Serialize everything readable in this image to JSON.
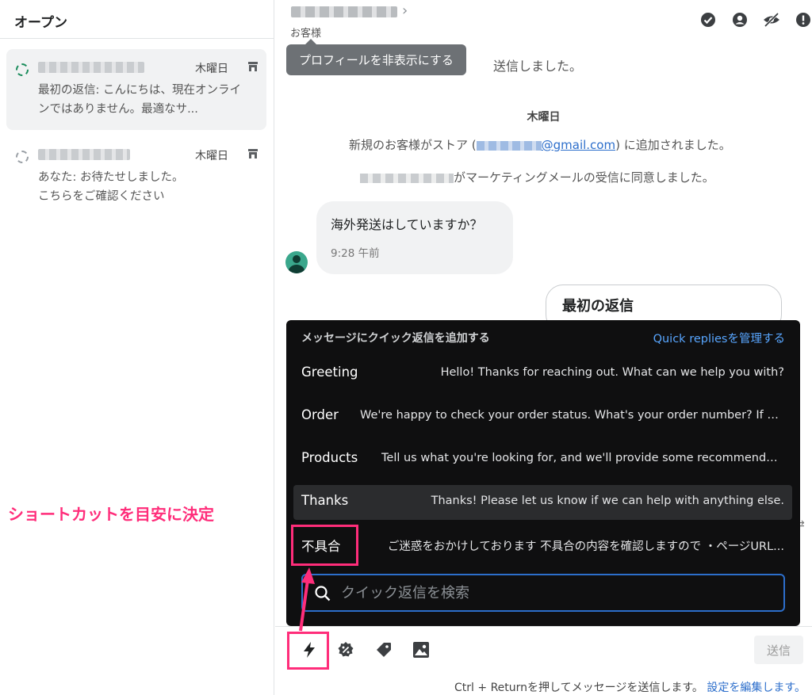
{
  "sidebar": {
    "title": "オープン",
    "conversations": [
      {
        "day": "木曜日",
        "preview": "最初の返信: こんにちは、現在オンラインではありません。最適なサ...",
        "selected": true
      },
      {
        "day": "木曜日",
        "preview_line1": "あなた: お待たせしました。",
        "preview_line2": "こちらをご確認ください",
        "selected": false
      }
    ]
  },
  "header": {
    "customer_label": "お客様",
    "icons": [
      "check-circle-icon",
      "profile-icon",
      "hide-icon",
      "alert-icon"
    ]
  },
  "tooltip": "プロフィールを非表示にする",
  "messages": {
    "partial_sent": "送信しました。",
    "day_label": "木曜日",
    "store_join_prefix": "新規のお客様がストア (",
    "email_suffix": "@gmail.com",
    "store_join_suffix": ") に追加されました。",
    "marketing": "がマーケティングメールの受信に同意しました。",
    "customer_message": "海外発送はしていますか？",
    "customer_time": "9:28 午前",
    "reply_card_title": "最初の返信"
  },
  "quick_replies": {
    "header": "メッセージにクイック返信を追加する",
    "manage_link": "Quick repliesを管理する",
    "items": [
      {
        "title": "Greeting",
        "text": "Hello! Thanks for reaching out. What can we help you with?"
      },
      {
        "title": "Order",
        "text": "We're happy to check your order status. What's your order number? If yo..."
      },
      {
        "title": "Products",
        "text": "Tell us what you're looking for, and we'll provide some recommendatio..."
      },
      {
        "title": "Thanks",
        "text": "Thanks! Please let us know if we can help with anything else."
      },
      {
        "title": "不具合",
        "text": "ご迷惑をおかけしております 不具合の内容を確認しますので ・ページURL..."
      }
    ],
    "search_placeholder": "クイック返信を検索"
  },
  "composer": {
    "tools": [
      "lightning-icon",
      "discount-icon",
      "tag-icon",
      "image-icon"
    ],
    "send_label": "送信",
    "hint": "Ctrl + Returnを押してメッセージを送信します。",
    "hint_link": "設定を編集します。"
  },
  "annotation": {
    "label": "ショートカットを目安に決定",
    "color": "#ff2d7a"
  }
}
